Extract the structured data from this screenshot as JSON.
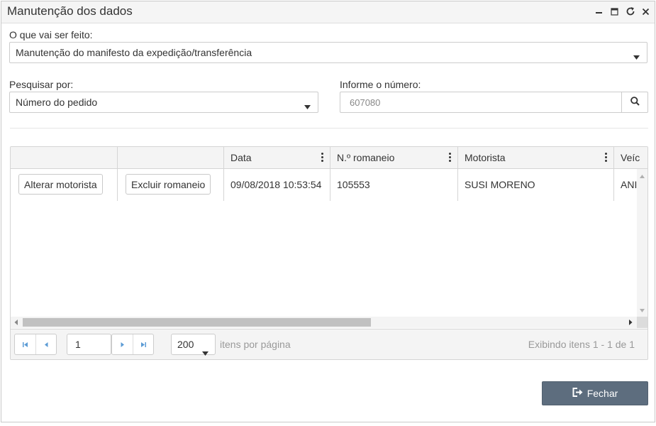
{
  "window": {
    "title": "Manutenção dos dados",
    "controls": [
      "minimize-icon",
      "maximize-icon",
      "refresh-icon",
      "close-icon"
    ]
  },
  "form": {
    "action_label": "O que vai ser feito:",
    "action_value": "Manutenção do manifesto da expedição/transferência",
    "search_by_label": "Pesquisar por:",
    "search_by_value": "Número do pedido",
    "number_label": "Informe o número:",
    "number_value": "607080"
  },
  "grid": {
    "columns": [
      "",
      "",
      "Data",
      "N.º romaneio",
      "Motorista",
      "Veíc"
    ],
    "rows": [
      {
        "change_driver_label": "Alterar motorista",
        "delete_label": "Excluir romaneio",
        "date": "09/08/2018 10:53:54",
        "romaneio": "105553",
        "driver": "SUSI MORENO",
        "vehicle": "ANI"
      }
    ]
  },
  "pager": {
    "page": "1",
    "page_size": "200",
    "per_page_label": "itens por página",
    "info": "Exibindo itens 1 - 1 de 1"
  },
  "footer": {
    "close_label": "Fechar"
  },
  "colors": {
    "primary_button": "#5d6d7e",
    "pager_icon": "#5b9bd5"
  }
}
